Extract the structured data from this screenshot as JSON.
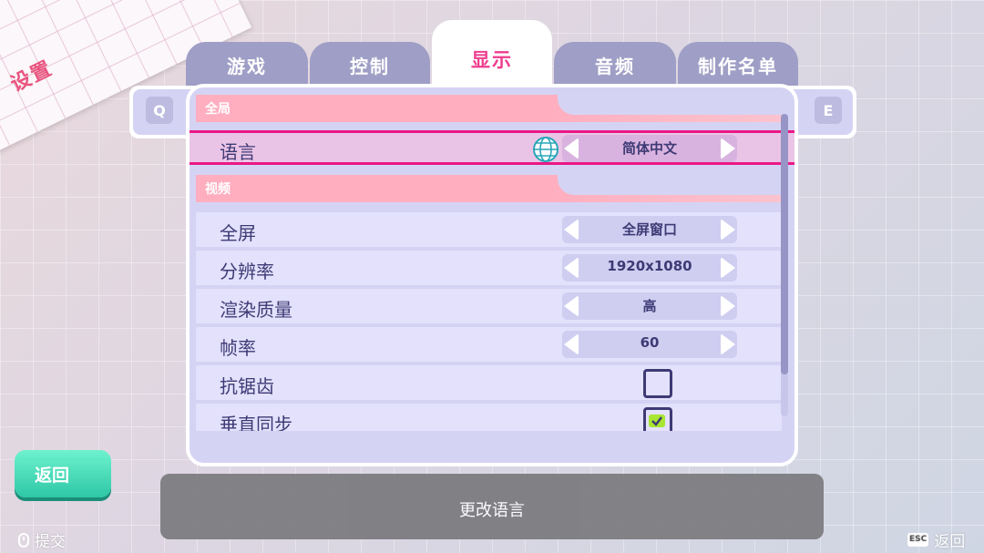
{
  "title": "设置",
  "tabs": [
    {
      "label": "游戏",
      "active": false
    },
    {
      "label": "控制",
      "active": false
    },
    {
      "label": "显示",
      "active": true
    },
    {
      "label": "音频",
      "active": false
    },
    {
      "label": "制作名单",
      "active": false
    }
  ],
  "keys": {
    "prev": "Q",
    "next": "E"
  },
  "sections": {
    "global": "全局",
    "video": "视频"
  },
  "settings": {
    "language": {
      "label": "语言",
      "value": "简体中文"
    },
    "fullscreen": {
      "label": "全屏",
      "value": "全屏窗口"
    },
    "resolution": {
      "label": "分辨率",
      "value": "1920x1080"
    },
    "quality": {
      "label": "渲染质量",
      "value": "高"
    },
    "framerate": {
      "label": "帧率",
      "value": "60"
    },
    "antialiasing": {
      "label": "抗锯齿",
      "checked": false
    },
    "vsync": {
      "label": "垂直同步",
      "checked": true
    }
  },
  "back_button": "返回",
  "description": "更改语言",
  "footer": {
    "submit_hint": "提交",
    "esc_key": "ESC",
    "back_hint": "返回"
  },
  "colors": {
    "accent": "#ea1786",
    "tab_active_text": "#ee3d8f",
    "panel": "#d5d3f4",
    "section_header": "#ffaebf",
    "back_button": "#2ec7a6"
  }
}
